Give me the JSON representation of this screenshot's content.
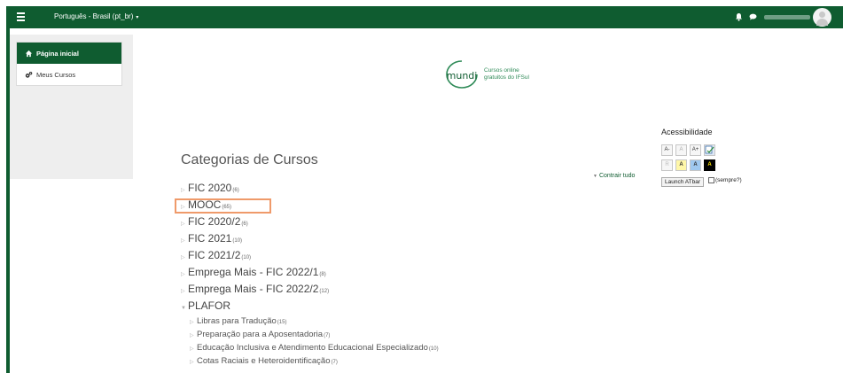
{
  "navbar": {
    "language": "Português - Brasil (pt_br)",
    "caret": "▾",
    "bg_color": "#0f5c30"
  },
  "sidebar": {
    "items": [
      {
        "label": "Página inicial",
        "icon": "home-icon",
        "active": true
      },
      {
        "label": "Meus Cursos",
        "icon": "cogs-icon",
        "active": false
      }
    ]
  },
  "logo": {
    "wordmark": "mundi",
    "tagline_line1": "Cursos online",
    "tagline_line2": "gratuitos do IFSul"
  },
  "main": {
    "title": "Categorias de Cursos",
    "collapse_label": "Contrair tudo",
    "categories": [
      {
        "name": "FIC 2020",
        "count": "(6)",
        "level": 0,
        "expanded": false
      },
      {
        "name": "MOOC",
        "count": "(65)",
        "level": 0,
        "expanded": false,
        "highlighted": true
      },
      {
        "name": "FIC 2020/2",
        "count": "(6)",
        "level": 0,
        "expanded": false
      },
      {
        "name": "FIC 2021",
        "count": "(10)",
        "level": 0,
        "expanded": false
      },
      {
        "name": "FIC 2021/2",
        "count": "(10)",
        "level": 0,
        "expanded": false
      },
      {
        "name": "Emprega Mais - FIC 2022/1",
        "count": "(8)",
        "level": 0,
        "expanded": false
      },
      {
        "name": "Emprega Mais - FIC 2022/2",
        "count": "(12)",
        "level": 0,
        "expanded": false
      },
      {
        "name": "PLAFOR",
        "count": "",
        "level": 0,
        "expanded": true
      },
      {
        "name": "Libras para Tradução",
        "count": "(15)",
        "level": 1,
        "expanded": false
      },
      {
        "name": "Preparação para a Aposentadoria",
        "count": "(7)",
        "level": 1,
        "expanded": false
      },
      {
        "name": "Educação Inclusiva e Atendimento Educacional Especializado",
        "count": "(10)",
        "level": 1,
        "expanded": false
      },
      {
        "name": "Cotas Raciais e Heteroidentificação",
        "count": "(7)",
        "level": 1,
        "expanded": false
      }
    ]
  },
  "accessibility": {
    "title": "Acessibilidade",
    "font_buttons": [
      "A-",
      "A",
      "A+"
    ],
    "contrast_buttons": [
      "R",
      "A",
      "A",
      "A"
    ],
    "launch_label": "Launch ATbar",
    "always_label": "(sempre?)"
  },
  "colors": {
    "brand_green": "#0f5c30",
    "highlight": "#ef9a6a"
  }
}
